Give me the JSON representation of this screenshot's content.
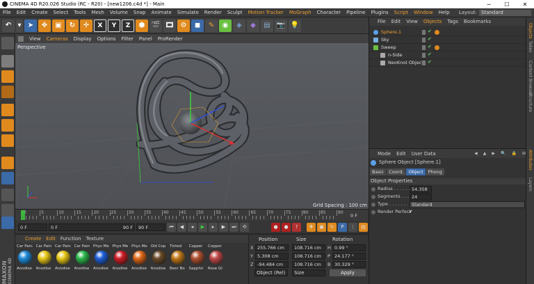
{
  "window": {
    "title": "CINEMA 4D R20.026 Studio (RC - R20) - [new1206.c4d *] - Main",
    "min": "─",
    "max": "☐",
    "close": "✕"
  },
  "menu": {
    "items": [
      {
        "label": "File",
        "hl": false
      },
      {
        "label": "Edit",
        "hl": false
      },
      {
        "label": "Create",
        "hl": false
      },
      {
        "label": "Select",
        "hl": false
      },
      {
        "label": "Tools",
        "hl": false
      },
      {
        "label": "Mesh",
        "hl": false
      },
      {
        "label": "Volume",
        "hl": false
      },
      {
        "label": "Snap",
        "hl": false
      },
      {
        "label": "Animate",
        "hl": false
      },
      {
        "label": "Simulate",
        "hl": false
      },
      {
        "label": "Render",
        "hl": false
      },
      {
        "label": "Sculpt",
        "hl": false
      },
      {
        "label": "Motion Tracker",
        "hl": true
      },
      {
        "label": "MoGraph",
        "hl": true
      },
      {
        "label": "Character",
        "hl": false
      },
      {
        "label": "Pipeline",
        "hl": false
      },
      {
        "label": "Plugins",
        "hl": false
      },
      {
        "label": "Script",
        "hl": true
      },
      {
        "label": "Window",
        "hl": true
      },
      {
        "label": "Help",
        "hl": false
      }
    ],
    "layout_label": "Layout:",
    "layout_value": "Standard"
  },
  "toolbar": {
    "x": "X",
    "y": "Y",
    "z": "Z"
  },
  "viewport": {
    "menu": [
      {
        "label": "View",
        "hl": false
      },
      {
        "label": "Cameras",
        "hl": true
      },
      {
        "label": "Display",
        "hl": false
      },
      {
        "label": "Options",
        "hl": false
      },
      {
        "label": "Filter",
        "hl": false
      },
      {
        "label": "Panel",
        "hl": false
      },
      {
        "label": "ProRender",
        "hl": false
      }
    ],
    "camera": "Perspective",
    "grid_spacing": "Grid Spacing : 100 cm"
  },
  "timeline": {
    "ticks": [
      "0",
      "5",
      "10",
      "15",
      "20",
      "25",
      "30",
      "35",
      "40",
      "45",
      "50",
      "55",
      "60",
      "65",
      "70",
      "75",
      "80",
      "85",
      "90"
    ],
    "end_label": "0 F",
    "current_frame": 0,
    "max_frame": 90
  },
  "playback": {
    "start": "0 F",
    "current": "0 F",
    "end": "90 F",
    "end2": "90 F"
  },
  "materials": {
    "menu": [
      {
        "label": "Create",
        "hl": true
      },
      {
        "label": "Edit",
        "hl": true
      },
      {
        "label": "Function",
        "hl": false
      },
      {
        "label": "Texture",
        "hl": false
      }
    ],
    "items": [
      {
        "top": "Car Pain",
        "bottom": "Anodise",
        "color": "#1d8ad8"
      },
      {
        "top": "Car Pain",
        "bottom": "Anodise",
        "color": "#e8c818"
      },
      {
        "top": "Car Pain",
        "bottom": "Anodise",
        "color": "#e8c818"
      },
      {
        "top": "Car Pain",
        "bottom": "Anodise",
        "color": "#2ab84a"
      },
      {
        "top": "Phys Me",
        "bottom": "Anodise",
        "color": "#1d5ed8"
      },
      {
        "top": "Phys Me",
        "bottom": "Anodise",
        "color": "#d01c24"
      },
      {
        "top": "Phys Me",
        "bottom": "Anodise",
        "color": "#e06818"
      },
      {
        "top": "Old Cop",
        "bottom": "Anodise",
        "color": "#6a4a28"
      },
      {
        "top": "Tinted",
        "bottom": "Beer Bo",
        "color": "#c07818"
      },
      {
        "top": "Copper",
        "bottom": "Sapphir",
        "color": "#b05030"
      },
      {
        "top": "Copper",
        "bottom": "Rose Gl",
        "color": "#c04848"
      }
    ]
  },
  "coords": {
    "headers": [
      "Position",
      "Size",
      "Rotation"
    ],
    "rows": [
      {
        "axis": "X",
        "pos": "255.766 cm",
        "size": "108.716 cm",
        "rl": "H",
        "rot": "0.99 °"
      },
      {
        "axis": "Y",
        "pos": "5.308 cm",
        "size": "108.716 cm",
        "rl": "P",
        "rot": "24.177 °"
      },
      {
        "axis": "Z",
        "pos": "-94.484 cm",
        "size": "108.716 cm",
        "rl": "B",
        "rot": "30.329 °"
      }
    ],
    "mode": "Object (Rel)",
    "size_mode": "Size",
    "apply": "Apply"
  },
  "objects": {
    "menu": [
      {
        "label": "File",
        "hl": false
      },
      {
        "label": "Edit",
        "hl": false
      },
      {
        "label": "View",
        "hl": false
      },
      {
        "label": "Objects",
        "hl": true
      },
      {
        "label": "Tags",
        "hl": false
      },
      {
        "label": "Bookmarks",
        "hl": false
      }
    ],
    "items": [
      {
        "name": "Sphere.1",
        "indent": 0,
        "color": "#f0a030",
        "icon": "sphere-icon"
      },
      {
        "name": "Sky",
        "indent": 0,
        "color": "#dcdcdc",
        "icon": "sky-icon"
      },
      {
        "name": "Sweep",
        "indent": 0,
        "color": "#dcdcdc",
        "icon": "sweep-icon"
      },
      {
        "name": "n-Side",
        "indent": 1,
        "color": "#dcdcdc",
        "icon": "nside-icon"
      },
      {
        "name": "NeoKnot Object",
        "indent": 1,
        "color": "#dcdcdc",
        "icon": "knot-icon"
      }
    ]
  },
  "attributes": {
    "menu": [
      "Mode",
      "Edit",
      "User Data"
    ],
    "object_title": "Sphere Object [Sphere.1]",
    "tabs": [
      {
        "label": "Basic",
        "active": false
      },
      {
        "label": "Coord.",
        "active": false
      },
      {
        "label": "Object",
        "active": true
      },
      {
        "label": "Phong",
        "active": false
      }
    ],
    "section": "Object Properties",
    "radius_label": "Radius . . . . . . . .",
    "radius": "54.358 cm",
    "segments_label": "Segments . . . . . .",
    "segments": "24",
    "type_label": "Type . . . . . . . . .",
    "type": "Standard",
    "render_perfect_label": "Render Perfect",
    "render_perfect": "✔"
  },
  "right_tabs": [
    {
      "label": "Objects",
      "active": true
    },
    {
      "label": "Takes",
      "active": false
    },
    {
      "label": "Content Browser",
      "active": false
    },
    {
      "label": "Structure",
      "active": false
    },
    {
      "label": "Attributes",
      "active": true
    },
    {
      "label": "Layers",
      "active": false
    }
  ],
  "branding": {
    "line1": "MAXON",
    "line2": "CINEMA 4D"
  },
  "colors": {
    "accent": "#f0a030",
    "blue": "#3b6aa8",
    "viewport_bg": "#5c5f63",
    "knot": "#505358"
  }
}
